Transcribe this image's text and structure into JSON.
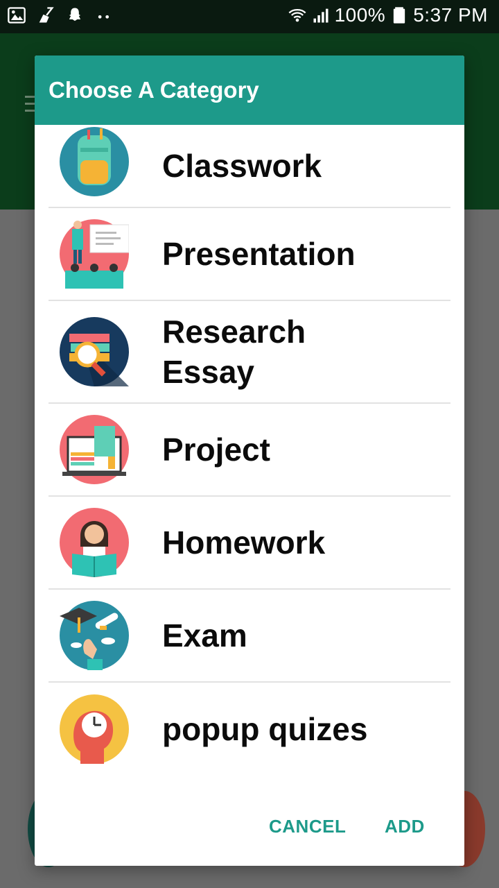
{
  "status_bar": {
    "battery": "100%",
    "time": "5:37 PM",
    "icons": [
      "image-icon",
      "broom-icon",
      "snapchat-icon",
      "more-dots-icon",
      "wifi-icon",
      "signal-icon",
      "battery-icon"
    ]
  },
  "dialog": {
    "title": "Choose A Category",
    "items": [
      {
        "label": "Classwork",
        "icon": "backpack-icon"
      },
      {
        "label": "Presentation",
        "icon": "presentation-icon"
      },
      {
        "label": "Research Essay",
        "icon": "research-books-icon"
      },
      {
        "label": "Project",
        "icon": "project-laptop-icon"
      },
      {
        "label": "Homework",
        "icon": "homework-reading-icon"
      },
      {
        "label": "Exam",
        "icon": "graduation-exam-icon"
      },
      {
        "label": "popup quizes",
        "icon": "clock-head-icon"
      }
    ],
    "buttons": {
      "cancel": "CANCEL",
      "add": "ADD"
    }
  },
  "colors": {
    "accent": "#1d9a8a",
    "app_toolbar": "#0b3d1b",
    "status_bar": "#0a1a10"
  }
}
